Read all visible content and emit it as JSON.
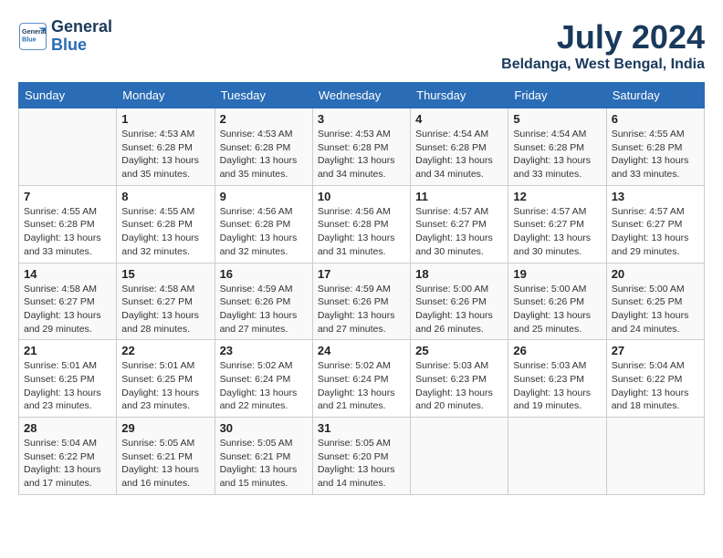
{
  "header": {
    "logo_line1": "General",
    "logo_line2": "Blue",
    "title": "July 2024",
    "subtitle": "Beldanga, West Bengal, India"
  },
  "days_of_week": [
    "Sunday",
    "Monday",
    "Tuesday",
    "Wednesday",
    "Thursday",
    "Friday",
    "Saturday"
  ],
  "weeks": [
    [
      {
        "day": "",
        "info": ""
      },
      {
        "day": "1",
        "info": "Sunrise: 4:53 AM\nSunset: 6:28 PM\nDaylight: 13 hours\nand 35 minutes."
      },
      {
        "day": "2",
        "info": "Sunrise: 4:53 AM\nSunset: 6:28 PM\nDaylight: 13 hours\nand 35 minutes."
      },
      {
        "day": "3",
        "info": "Sunrise: 4:53 AM\nSunset: 6:28 PM\nDaylight: 13 hours\nand 34 minutes."
      },
      {
        "day": "4",
        "info": "Sunrise: 4:54 AM\nSunset: 6:28 PM\nDaylight: 13 hours\nand 34 minutes."
      },
      {
        "day": "5",
        "info": "Sunrise: 4:54 AM\nSunset: 6:28 PM\nDaylight: 13 hours\nand 33 minutes."
      },
      {
        "day": "6",
        "info": "Sunrise: 4:55 AM\nSunset: 6:28 PM\nDaylight: 13 hours\nand 33 minutes."
      }
    ],
    [
      {
        "day": "7",
        "info": "Sunrise: 4:55 AM\nSunset: 6:28 PM\nDaylight: 13 hours\nand 33 minutes."
      },
      {
        "day": "8",
        "info": "Sunrise: 4:55 AM\nSunset: 6:28 PM\nDaylight: 13 hours\nand 32 minutes."
      },
      {
        "day": "9",
        "info": "Sunrise: 4:56 AM\nSunset: 6:28 PM\nDaylight: 13 hours\nand 32 minutes."
      },
      {
        "day": "10",
        "info": "Sunrise: 4:56 AM\nSunset: 6:28 PM\nDaylight: 13 hours\nand 31 minutes."
      },
      {
        "day": "11",
        "info": "Sunrise: 4:57 AM\nSunset: 6:27 PM\nDaylight: 13 hours\nand 30 minutes."
      },
      {
        "day": "12",
        "info": "Sunrise: 4:57 AM\nSunset: 6:27 PM\nDaylight: 13 hours\nand 30 minutes."
      },
      {
        "day": "13",
        "info": "Sunrise: 4:57 AM\nSunset: 6:27 PM\nDaylight: 13 hours\nand 29 minutes."
      }
    ],
    [
      {
        "day": "14",
        "info": "Sunrise: 4:58 AM\nSunset: 6:27 PM\nDaylight: 13 hours\nand 29 minutes."
      },
      {
        "day": "15",
        "info": "Sunrise: 4:58 AM\nSunset: 6:27 PM\nDaylight: 13 hours\nand 28 minutes."
      },
      {
        "day": "16",
        "info": "Sunrise: 4:59 AM\nSunset: 6:26 PM\nDaylight: 13 hours\nand 27 minutes."
      },
      {
        "day": "17",
        "info": "Sunrise: 4:59 AM\nSunset: 6:26 PM\nDaylight: 13 hours\nand 27 minutes."
      },
      {
        "day": "18",
        "info": "Sunrise: 5:00 AM\nSunset: 6:26 PM\nDaylight: 13 hours\nand 26 minutes."
      },
      {
        "day": "19",
        "info": "Sunrise: 5:00 AM\nSunset: 6:26 PM\nDaylight: 13 hours\nand 25 minutes."
      },
      {
        "day": "20",
        "info": "Sunrise: 5:00 AM\nSunset: 6:25 PM\nDaylight: 13 hours\nand 24 minutes."
      }
    ],
    [
      {
        "day": "21",
        "info": "Sunrise: 5:01 AM\nSunset: 6:25 PM\nDaylight: 13 hours\nand 23 minutes."
      },
      {
        "day": "22",
        "info": "Sunrise: 5:01 AM\nSunset: 6:25 PM\nDaylight: 13 hours\nand 23 minutes."
      },
      {
        "day": "23",
        "info": "Sunrise: 5:02 AM\nSunset: 6:24 PM\nDaylight: 13 hours\nand 22 minutes."
      },
      {
        "day": "24",
        "info": "Sunrise: 5:02 AM\nSunset: 6:24 PM\nDaylight: 13 hours\nand 21 minutes."
      },
      {
        "day": "25",
        "info": "Sunrise: 5:03 AM\nSunset: 6:23 PM\nDaylight: 13 hours\nand 20 minutes."
      },
      {
        "day": "26",
        "info": "Sunrise: 5:03 AM\nSunset: 6:23 PM\nDaylight: 13 hours\nand 19 minutes."
      },
      {
        "day": "27",
        "info": "Sunrise: 5:04 AM\nSunset: 6:22 PM\nDaylight: 13 hours\nand 18 minutes."
      }
    ],
    [
      {
        "day": "28",
        "info": "Sunrise: 5:04 AM\nSunset: 6:22 PM\nDaylight: 13 hours\nand 17 minutes."
      },
      {
        "day": "29",
        "info": "Sunrise: 5:05 AM\nSunset: 6:21 PM\nDaylight: 13 hours\nand 16 minutes."
      },
      {
        "day": "30",
        "info": "Sunrise: 5:05 AM\nSunset: 6:21 PM\nDaylight: 13 hours\nand 15 minutes."
      },
      {
        "day": "31",
        "info": "Sunrise: 5:05 AM\nSunset: 6:20 PM\nDaylight: 13 hours\nand 14 minutes."
      },
      {
        "day": "",
        "info": ""
      },
      {
        "day": "",
        "info": ""
      },
      {
        "day": "",
        "info": ""
      }
    ]
  ]
}
